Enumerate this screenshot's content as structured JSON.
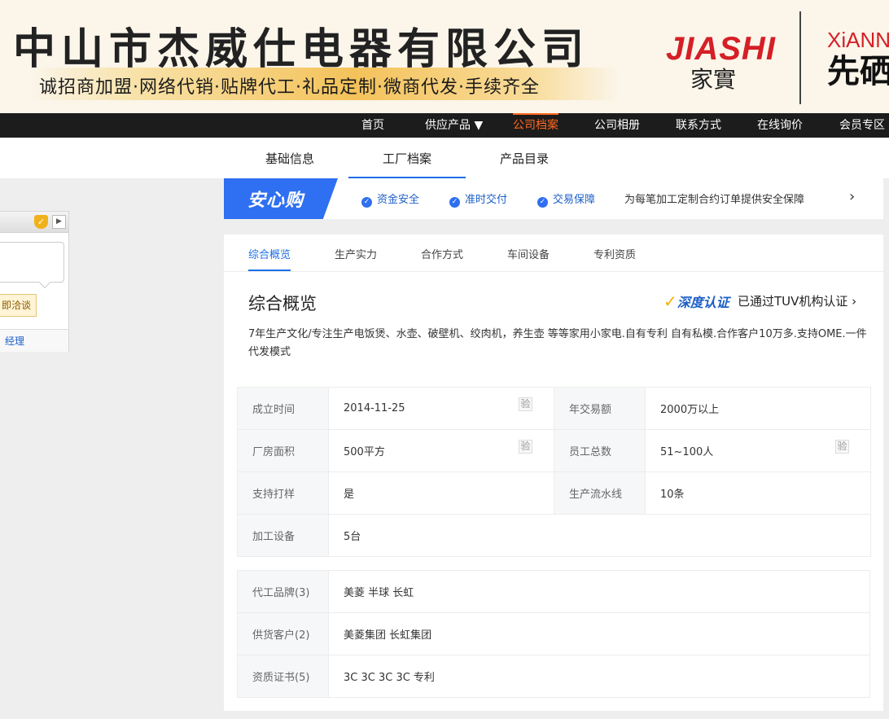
{
  "banner": {
    "company_name": "中山市杰威仕电器有限公司",
    "slogan": "诚招商加盟·网络代销·贴牌代工·礼品定制·微商代发·手续齐全",
    "brand1_en": "JIASHI",
    "brand1_cn": "家實",
    "brand2_en": "XiANN",
    "brand2_cn": "先硒"
  },
  "nav": {
    "items": [
      "首页",
      "供应产品 ▼",
      "公司档案",
      "公司相册",
      "联系方式",
      "在线询价",
      "会员专区"
    ],
    "active_index": 2
  },
  "subnav": {
    "items": [
      "基础信息",
      "工厂档案",
      "产品目录"
    ],
    "active_index": 1
  },
  "sidebar": {
    "button_label": "即洽谈",
    "link_text": "经理"
  },
  "secure": {
    "logo_text": "安心购",
    "items": [
      "资金安全",
      "准时交付",
      "交易保障"
    ],
    "text": "为每笔加工定制合约订单提供安全保障"
  },
  "panel": {
    "tabs": [
      "综合概览",
      "生产实力",
      "合作方式",
      "车间设备",
      "专利资质"
    ],
    "active_tab": 0,
    "section_title": "综合概览",
    "cert_badge": "深度认证",
    "cert_text": "已通过TUV机构认证 ›",
    "description": "7年生产文化/专注生产电饭煲、水壶、破壁机、绞肉机，养生壶 等等家用小家电.自有专利 自有私模.合作客户10万多.支持OME.一件代发模式",
    "verify_label": "验",
    "facts": {
      "founded_label": "成立时间",
      "founded_value": "2014-11-25",
      "trade_label": "年交易额",
      "trade_value": "2000万以上",
      "area_label": "厂房面积",
      "area_value": "500平方",
      "staff_label": "员工总数",
      "staff_value": "51~100人",
      "sample_label": "支持打样",
      "sample_value": "是",
      "lines_label": "生产流水线",
      "lines_value": "10条",
      "equip_label": "加工设备",
      "equip_value": "5台"
    },
    "partners": {
      "brands_label": "代工品牌(3)",
      "brands_value": "美菱 半球 长虹",
      "clients_label": "供货客户(2)",
      "clients_value": "美菱集团 长虹集团",
      "certs_label": "资质证书(5)",
      "certs_value": "3C 3C 3C 3C 专利"
    }
  },
  "colors": {
    "accent_blue": "#1f6fe8",
    "nav_active": "#ff6a1f",
    "brand_red": "#d51f26"
  }
}
